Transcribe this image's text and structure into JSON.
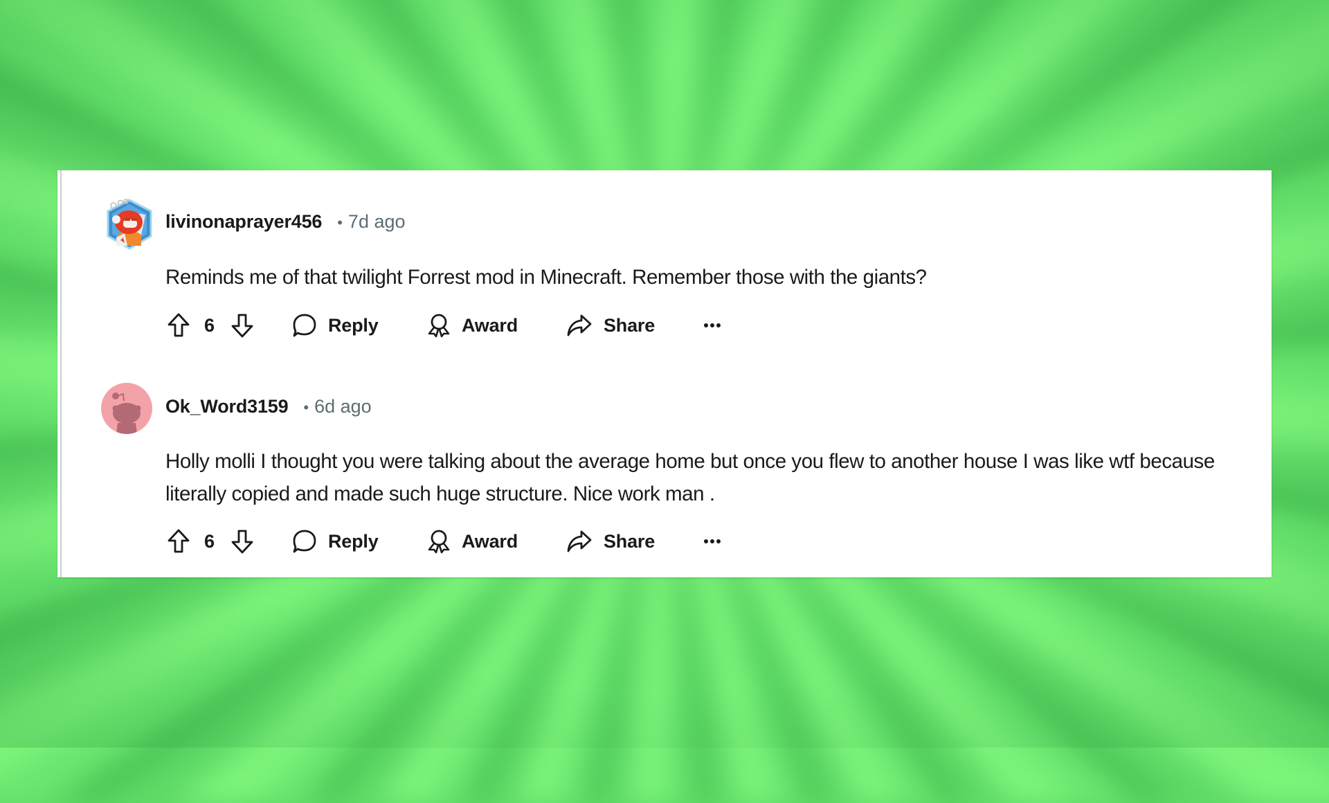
{
  "comments": [
    {
      "username": "livinonaprayer456",
      "separator": "•",
      "time": "7d ago",
      "avatar": "snoo-avatar-red-helmet",
      "body": "Reminds me of that twilight Forrest mod in Minecraft. Remember those with the giants?",
      "votes": "6",
      "actions": {
        "reply": "Reply",
        "award": "Award",
        "share": "Share",
        "more": "···"
      }
    },
    {
      "username": "Ok_Word3159",
      "separator": "•",
      "time": "6d ago",
      "avatar": "default-snoo-pink",
      "body": "Holly molli I thought you were talking about the average home but once you flew to another house I was like wtf because literally copied and made such huge structure. Nice work man .",
      "votes": "6",
      "actions": {
        "reply": "Reply",
        "award": "Award",
        "share": "Share",
        "more": "···"
      }
    }
  ],
  "colors": {
    "background_green_light": "#7cf47a",
    "background_green_dark": "#46bf52",
    "text_primary": "#1a1a1b",
    "text_meta": "#5c6c74",
    "avatar_pink": "#f4a2a9"
  }
}
